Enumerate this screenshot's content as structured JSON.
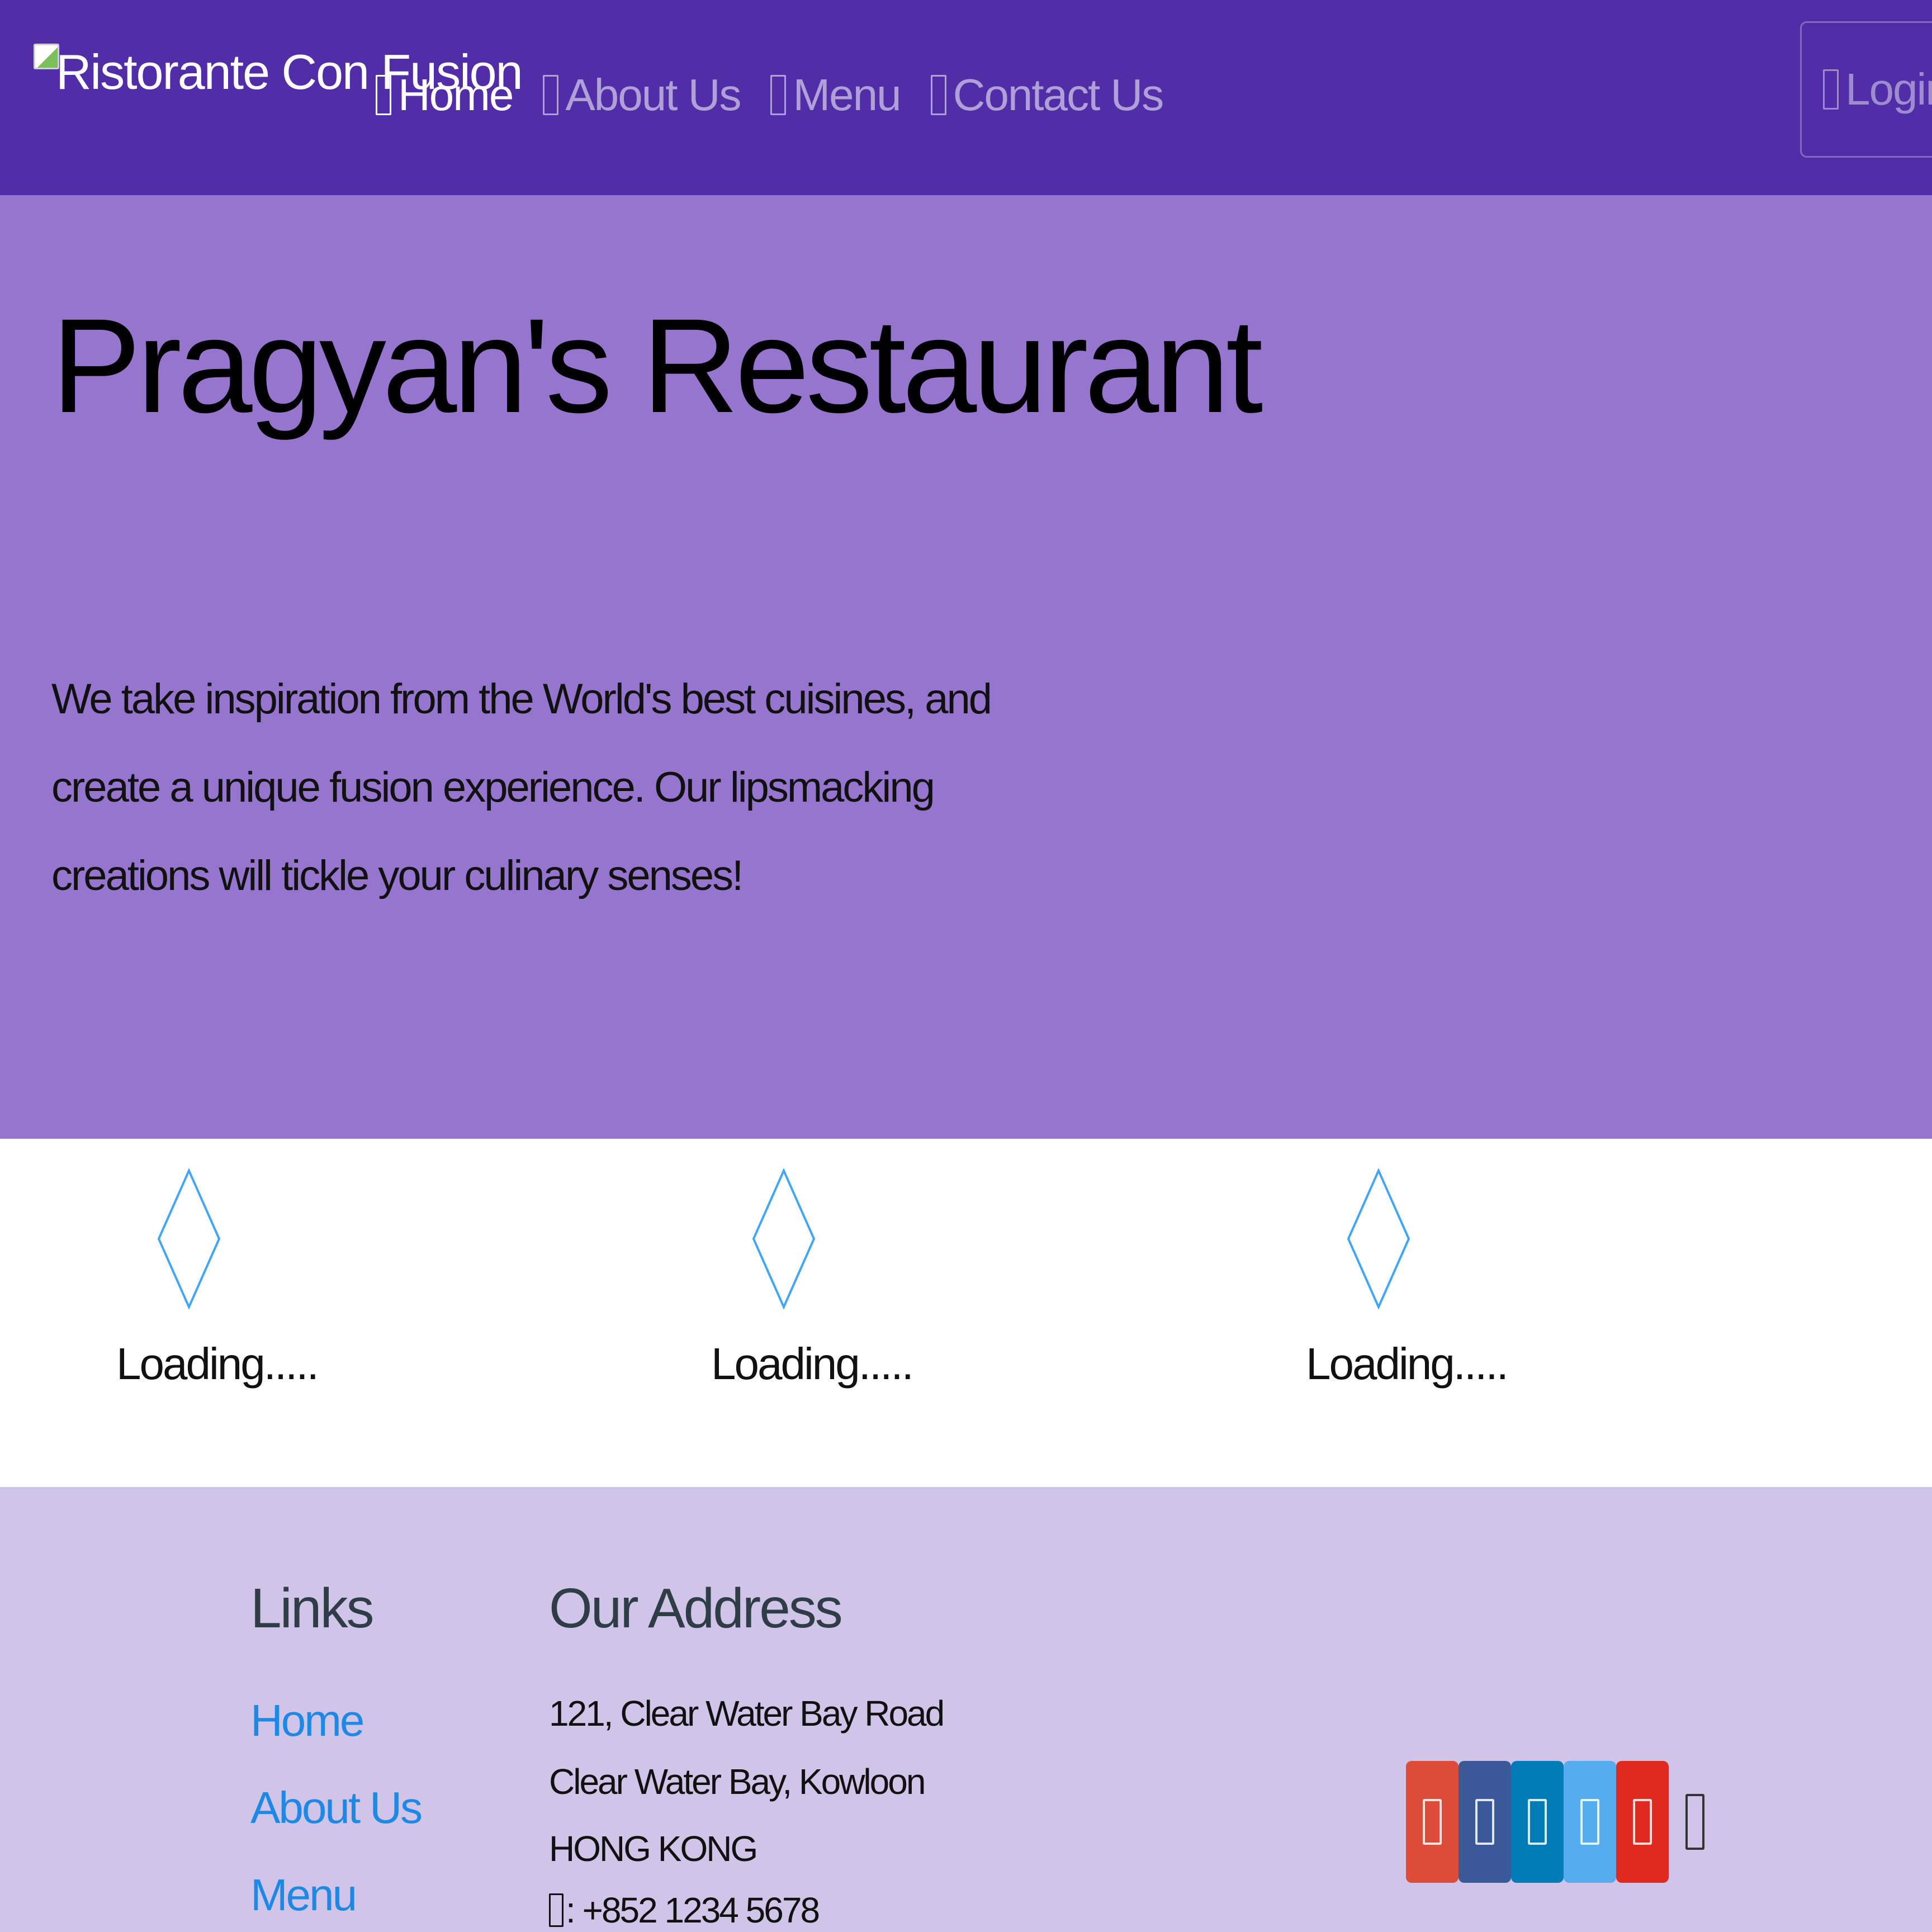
{
  "navbar": {
    "brand": "Ristorante Con Fusion",
    "items": [
      {
        "label": "Home",
        "active": true
      },
      {
        "label": "About Us",
        "active": false
      },
      {
        "label": "Menu",
        "active": false
      },
      {
        "label": "Contact Us",
        "active": false
      }
    ],
    "login_label": "Login"
  },
  "hero": {
    "title": "Pragyan's Restaurant",
    "text": "We take inspiration from the World's best cuisines, and create a unique fusion experience. Our lipsmacking creations will tickle your culinary senses!"
  },
  "loading": {
    "items": [
      {
        "label": "Loading....."
      },
      {
        "label": "Loading....."
      },
      {
        "label": "Loading....."
      }
    ]
  },
  "footer": {
    "links_heading": "Links",
    "links": [
      "Home",
      "About Us",
      "Menu"
    ],
    "address_heading": "Our Address",
    "address_lines": [
      "121, Clear Water Bay Road",
      "Clear Water Bay, Kowloon",
      "HONG KONG"
    ],
    "phone": ": +852 1234 5678",
    "social": [
      {
        "icon": "google-plus-icon",
        "color": "#dd4b39"
      },
      {
        "icon": "facebook-icon",
        "color": "#3b5998"
      },
      {
        "icon": "linkedin-icon",
        "color": "#007bb6"
      },
      {
        "icon": "twitter-icon",
        "color": "#55acee"
      },
      {
        "icon": "youtube-icon",
        "color": "#e02a20"
      },
      {
        "icon": "mail-icon",
        "color": "#333333"
      }
    ]
  },
  "colors": {
    "navbar": "#512da8",
    "jumbotron": "#9575cd",
    "footer": "#d1c4e9",
    "link": "#1e88e5"
  }
}
